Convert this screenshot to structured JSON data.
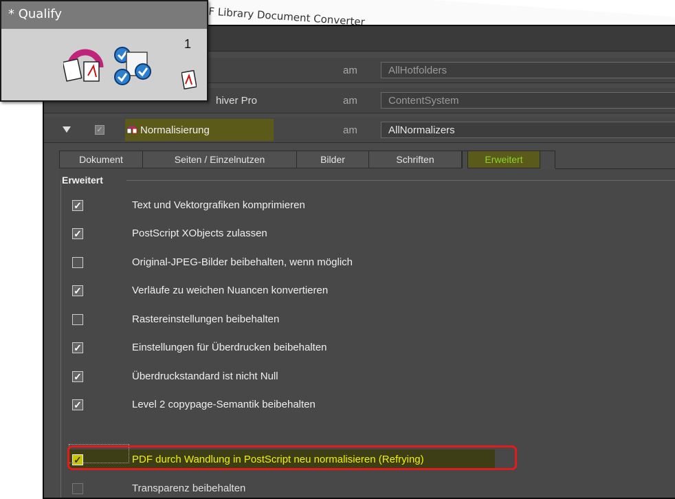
{
  "background_document": {
    "title_fragment": "eights™ PDF Library Document Converter"
  },
  "qualify_popup": {
    "title": "* Qualify",
    "count": "1"
  },
  "rows": [
    {
      "label": "",
      "am": "am",
      "value": "AllHotfolders"
    },
    {
      "label": "hiver Pro",
      "am": "am",
      "value": "ContentSystem"
    }
  ],
  "normalize_row": {
    "label": "Normalisierung",
    "am": "am",
    "value": "AllNormalizers",
    "checked": true
  },
  "tabs": [
    {
      "label": "Dokument",
      "active": false
    },
    {
      "label": "Seiten / Einzelnutzen",
      "active": false
    },
    {
      "label": "Bilder",
      "active": false
    },
    {
      "label": "Schriften",
      "active": false
    },
    {
      "label": "Erweitert",
      "active": true
    }
  ],
  "group": {
    "title": "Erweitert",
    "options": [
      {
        "label": "Text und Vektorgrafiken komprimieren",
        "checked": true
      },
      {
        "label": "PostScript XObjects zulassen",
        "checked": true
      },
      {
        "label": "Original-JPEG-Bilder beibehalten, wenn möglich",
        "checked": false
      },
      {
        "label": "Verläufe zu weichen Nuancen konvertieren",
        "checked": true
      },
      {
        "label": "Rastereinstellungen beibehalten",
        "checked": false
      },
      {
        "label": "Einstellungen für Überdrucken beibehalten",
        "checked": true
      },
      {
        "label": "Überdruckstandard ist nicht Null",
        "checked": true
      },
      {
        "label": "Level 2 copypage-Semantik beibehalten",
        "checked": true
      },
      {
        "label": "PDF durch Wandlung in PostScript neu normalisieren (Refrying)",
        "checked": true,
        "highlighted": true
      },
      {
        "label": "Transparenz beibehalten",
        "checked": false,
        "disabled": true
      }
    ]
  },
  "colors": {
    "panel_bg": "#4a4a4a",
    "highlight": "#f2f200",
    "active_tab_text": "#8ed42c",
    "callout_red": "#e21b1b"
  }
}
